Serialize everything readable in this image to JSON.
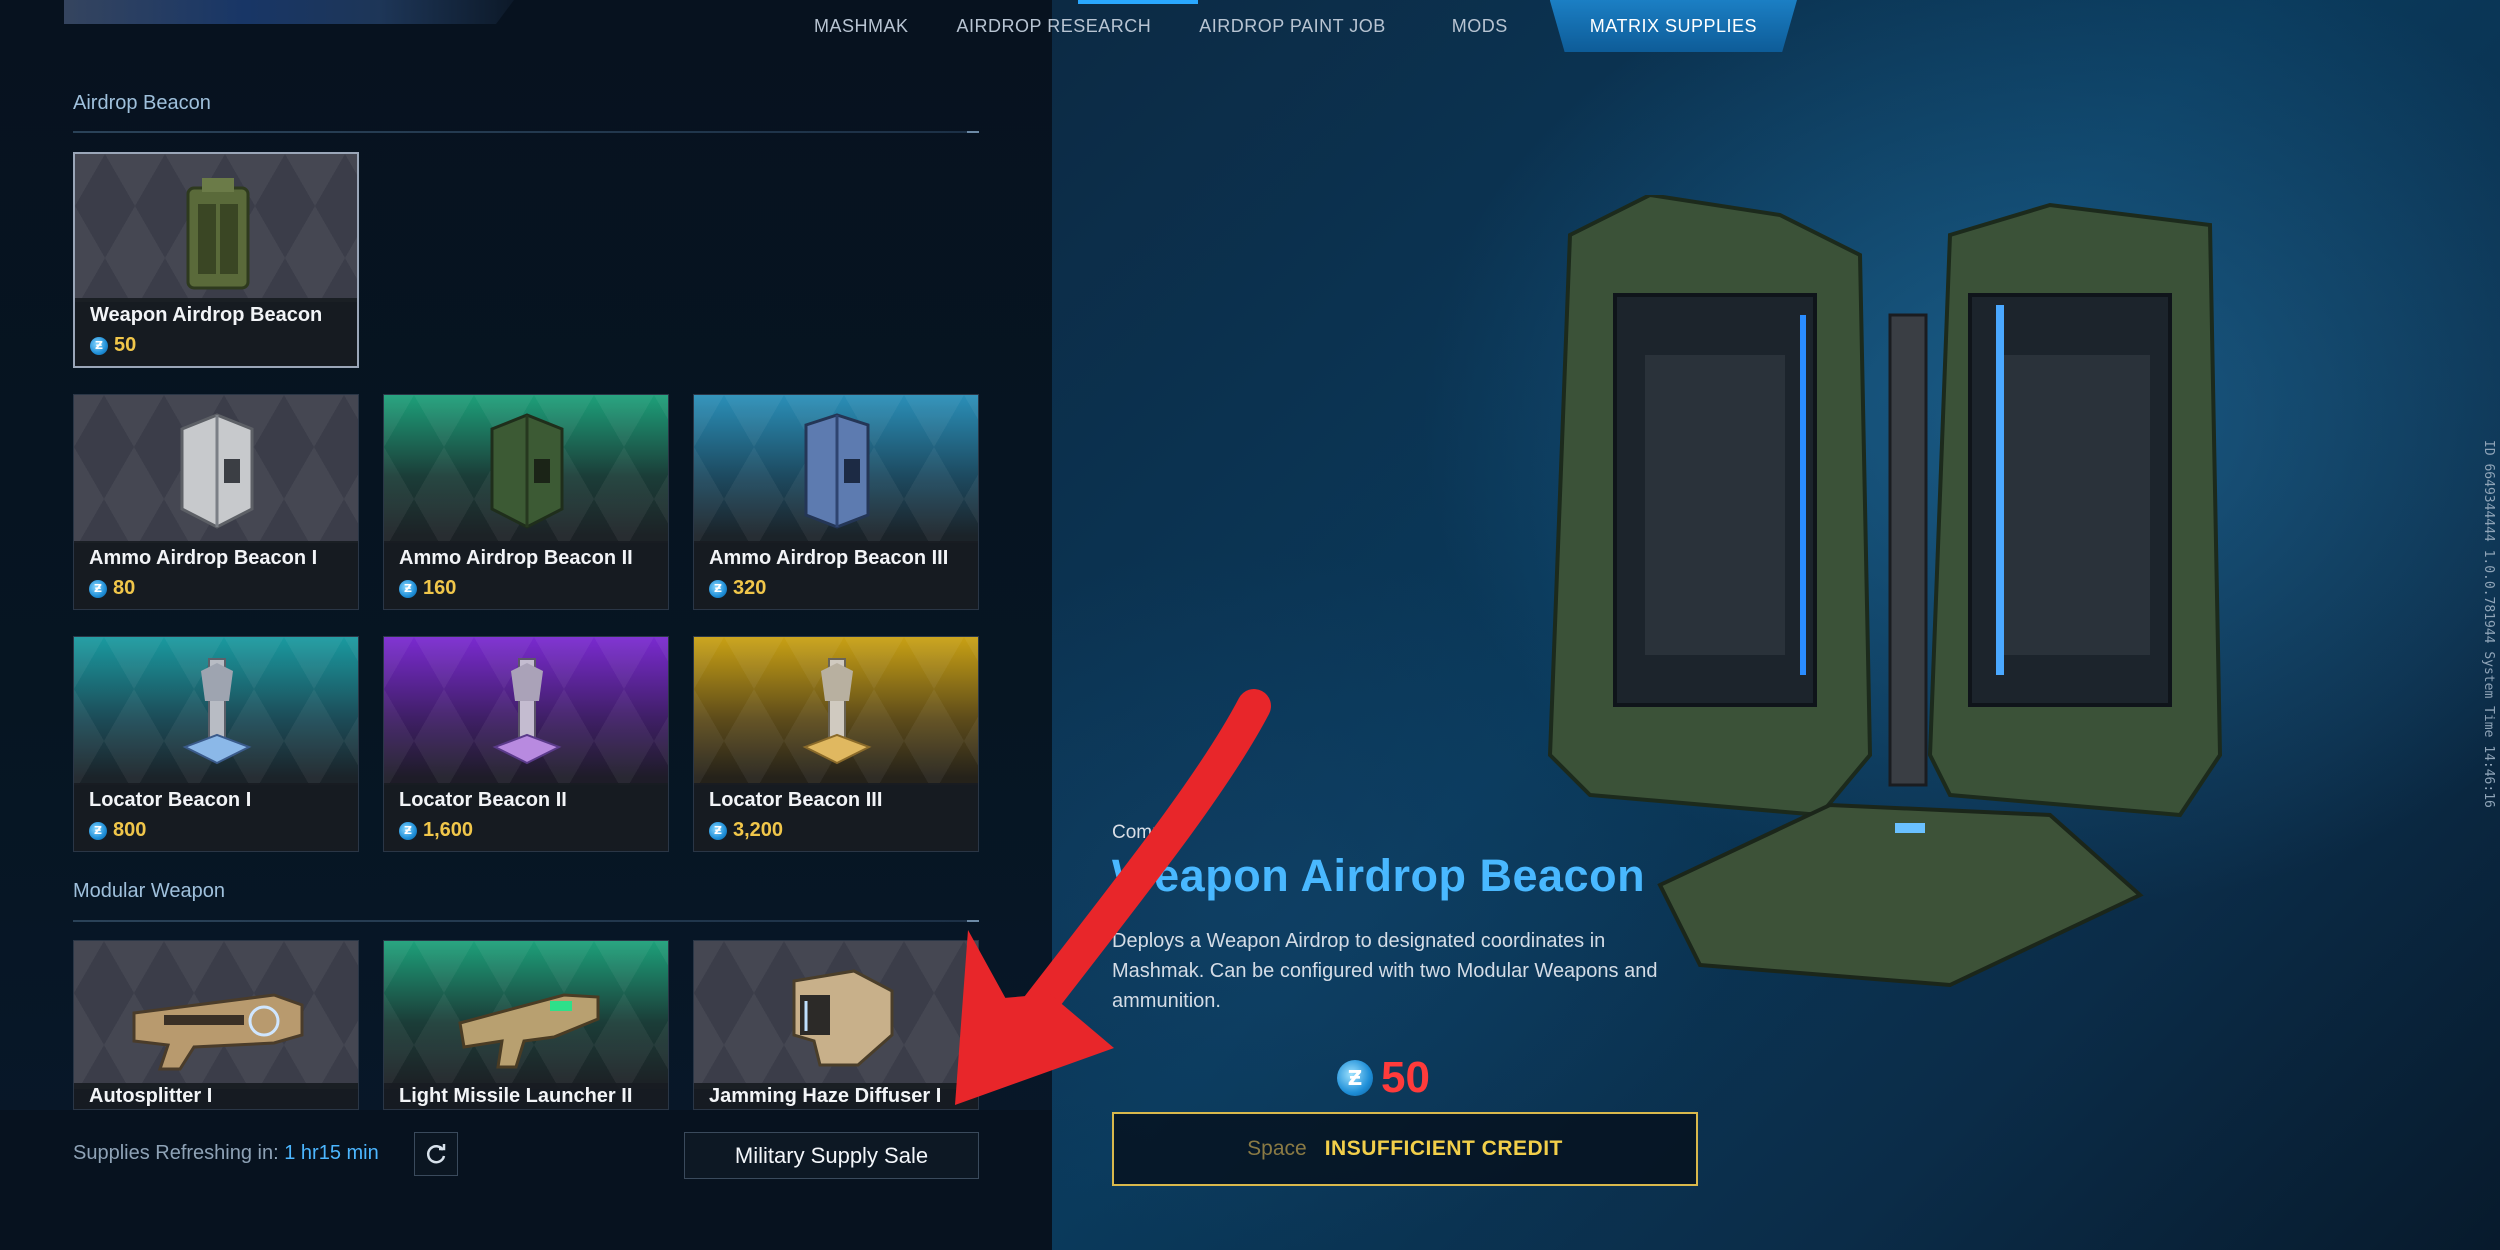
{
  "nav": {
    "tabs": [
      {
        "label": "MASHMAK"
      },
      {
        "label": "AIRDROP RESEARCH"
      },
      {
        "label": "AIRDROP PAINT JOB"
      },
      {
        "label": "MODS"
      },
      {
        "label": "MATRIX SUPPLIES"
      }
    ],
    "active_tab": "MATRIX SUPPLIES"
  },
  "sections": [
    {
      "title": "Airdrop Beacon"
    },
    {
      "title": "Modular Weapon"
    }
  ],
  "items": [
    {
      "name": "Weapon Airdrop Beacon",
      "price": "50",
      "tier": "gray",
      "selected": true
    },
    {
      "name": "Ammo Airdrop Beacon I",
      "price": "80",
      "tier": "gray"
    },
    {
      "name": "Ammo Airdrop Beacon II",
      "price": "160",
      "tier": "green"
    },
    {
      "name": "Ammo Airdrop Beacon III",
      "price": "320",
      "tier": "blue"
    },
    {
      "name": "Locator Beacon I",
      "price": "800",
      "tier": "teal"
    },
    {
      "name": "Locator Beacon II",
      "price": "1,600",
      "tier": "purple"
    },
    {
      "name": "Locator Beacon III",
      "price": "3,200",
      "tier": "gold"
    },
    {
      "name": "Autosplitter I",
      "tier": "gray"
    },
    {
      "name": "Light Missile Launcher II",
      "tier": "green"
    },
    {
      "name": "Jamming Haze Diffuser I",
      "tier": "gray"
    }
  ],
  "footer": {
    "refresh_label": "Supplies Refreshing in:",
    "refresh_time": "1 hr15 min",
    "sale_button": "Military Supply Sale"
  },
  "detail": {
    "rarity": "Common",
    "name": "Weapon Airdrop Beacon",
    "description": "Deploys a Weapon Airdrop to designated coordinates in Mashmak. Can be configured with two Modular Weapons and ammunition.",
    "price": "50",
    "buy_key": "Space",
    "buy_label": "INSUFFICIENT CREDIT"
  },
  "side_info": {
    "text": "ID 6649344444   1.0.0.781944   System Time   14:46:16"
  },
  "colors": {
    "accent": "#49b8ff",
    "price_gold": "#f0c64a",
    "insufficient_red": "#ff3b3b",
    "annotation_red": "#e8262a"
  }
}
